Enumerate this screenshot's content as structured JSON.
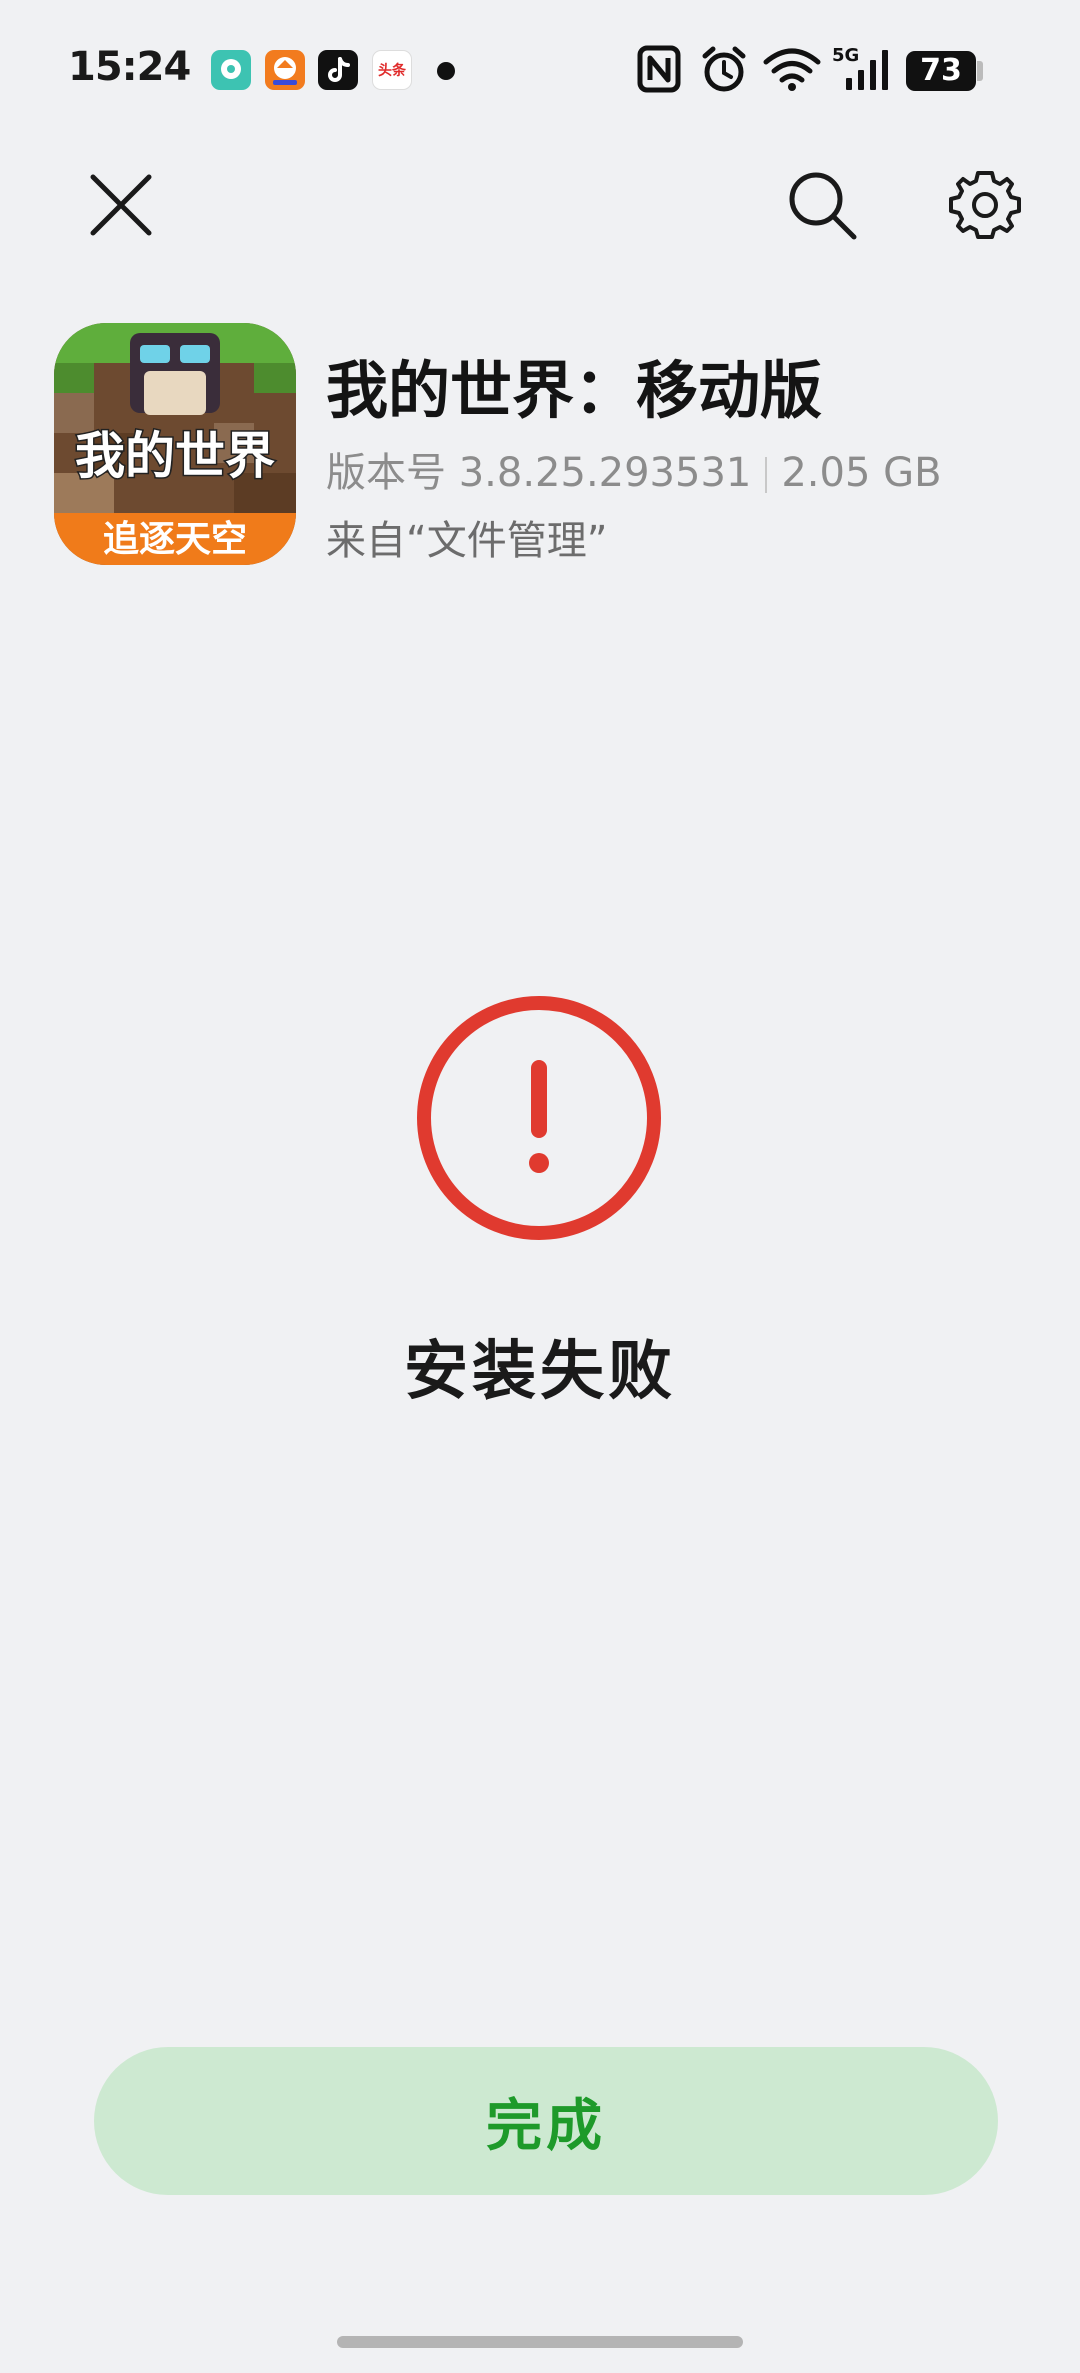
{
  "status_bar": {
    "time": "15:24",
    "notification_icons": [
      "bubble-app-icon",
      "fox-app-icon",
      "tiktok-icon",
      "toutiao-icon"
    ],
    "toutiao_label": "头条",
    "system_icons": [
      "nfc-icon",
      "alarm-icon",
      "wifi-icon",
      "5g-signal-icon"
    ],
    "network_label": "5G",
    "battery": "73"
  },
  "toolbar": {
    "close_icon": "close-icon",
    "search_icon": "search-icon",
    "settings_icon": "gear-icon"
  },
  "app": {
    "name": "我的世界：移动版",
    "version": "版本号 3.8.25.293531",
    "size": "2.05 GB",
    "source": "来自“文件管理”",
    "icon_title": "我的世界",
    "icon_subtitle": "追逐天空"
  },
  "install_status": {
    "icon": "error-exclamation-icon",
    "text": "安装失败",
    "color": "#e03a2f"
  },
  "actions": {
    "done_label": "完成",
    "done_bg": "#cde9d1",
    "done_text_color": "#1e9a2a"
  }
}
